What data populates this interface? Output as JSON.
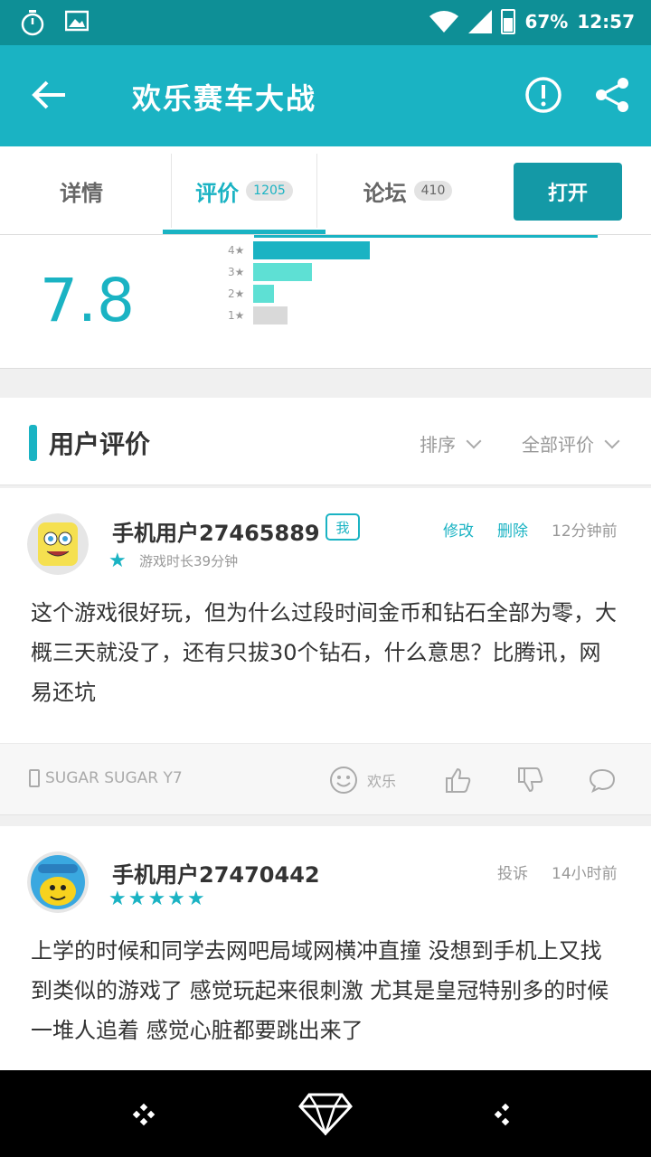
{
  "status_bar": {
    "battery": "67%",
    "time": "12:57"
  },
  "app_bar": {
    "title": "欢乐赛车大战"
  },
  "tabs": [
    {
      "label": "详情",
      "count": ""
    },
    {
      "label": "评价",
      "count": "1205"
    },
    {
      "label": "论坛",
      "count": "410"
    }
  ],
  "open_button": "打开",
  "rating": {
    "score": "7.8",
    "bars": [
      {
        "label": "4★",
        "fraction": 0.34,
        "color": "#1ab3c3"
      },
      {
        "label": "3★",
        "fraction": 0.17,
        "color": "#5ee0d4"
      },
      {
        "label": "2★",
        "fraction": 0.06,
        "color": "#5ee0d4"
      },
      {
        "label": "1★",
        "fraction": 0.1,
        "color": "#d9d9d9"
      }
    ]
  },
  "section": {
    "title": "用户评价",
    "sort_label": "排序",
    "filter_label": "全部评价"
  },
  "reviews": [
    {
      "username": "手机用户27465889",
      "badge": "我",
      "edit": "修改",
      "delete": "删除",
      "time": "12分钟前",
      "stars": "★",
      "playtime": "游戏时长39分钟",
      "body": "这个游戏很好玩，但为什么过段时间金币和钻石全部为零，大概三天就没了，还有只拔30个钻石，什么意思？比腾讯，网易还坑",
      "device": "SUGAR SUGAR Y7",
      "fun_label": "欢乐"
    },
    {
      "username": "手机用户27470442",
      "report": "投诉",
      "time": "14小时前",
      "stars": "★★★★★",
      "body": "上学的时候和同学去网吧局域网横冲直撞 没想到手机上又找到类似的游戏了 感觉玩起来很刺激 尤其是皇冠特别多的时候 一堆人追着 感觉心脏都要跳出来了"
    }
  ],
  "icons": [
    "timer-icon",
    "image-icon",
    "wifi-icon",
    "signal-icon",
    "battery-icon",
    "back-arrow-icon",
    "report-icon",
    "share-icon",
    "smile-icon",
    "thumbs-up-icon",
    "thumbs-down-icon",
    "comment-icon",
    "nav-diamond-icon"
  ],
  "colors": {
    "accent": "#1ab3c3",
    "status_bar": "#0e8f96",
    "open_button": "#1499a6"
  }
}
